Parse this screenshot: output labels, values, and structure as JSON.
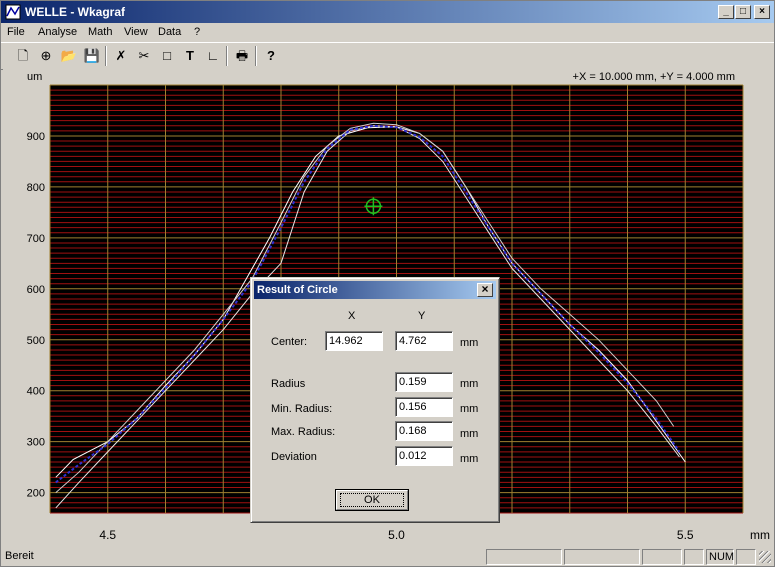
{
  "window": {
    "title": "WELLE - Wkagraf"
  },
  "title_buttons": {
    "minimize": "_",
    "maximize": "□",
    "close": "×"
  },
  "menu": [
    "File",
    "Analyse",
    "Math",
    "View",
    "Data",
    "?"
  ],
  "toolbar": {
    "tools": [
      {
        "name": "new-icon",
        "glyph": "🗋"
      },
      {
        "name": "add-icon",
        "glyph": "⊕"
      },
      {
        "name": "open-icon",
        "glyph": "📂"
      },
      {
        "name": "save-icon",
        "glyph": "💾"
      },
      {
        "name": "cut-x-icon",
        "glyph": "✗"
      },
      {
        "name": "scissors-icon",
        "glyph": "✂"
      },
      {
        "name": "rectangle-icon",
        "glyph": "□"
      },
      {
        "name": "text-icon",
        "glyph": "T"
      },
      {
        "name": "axis-icon",
        "glyph": "∟"
      },
      {
        "name": "print-icon",
        "glyph": "🖶"
      },
      {
        "name": "help-icon",
        "glyph": "?"
      }
    ]
  },
  "chart_header": {
    "unit_left": "um",
    "scale_info": "+X = 10.000 mm, +Y = 4.000 mm"
  },
  "chart_data": {
    "type": "line",
    "xlabel": "mm",
    "ylabel": "um",
    "xlim": [
      4.4,
      5.6
    ],
    "ylim": [
      160,
      1000
    ],
    "x_ticks": [
      "4.5",
      "5.0",
      "5.5"
    ],
    "y_ticks": [
      "200",
      "300",
      "400",
      "500",
      "600",
      "700",
      "800",
      "900"
    ],
    "background": "#000000",
    "grid_color_minor": "#a01010",
    "grid_color_major": "#a08030",
    "series": [
      {
        "color": "#ffffff",
        "values": [
          [
            4.41,
            230
          ],
          [
            4.44,
            265
          ],
          [
            4.5,
            300
          ],
          [
            4.55,
            345
          ],
          [
            4.6,
            410
          ],
          [
            4.65,
            470
          ],
          [
            4.7,
            540
          ],
          [
            4.74,
            620
          ],
          [
            4.78,
            700
          ],
          [
            4.82,
            790
          ],
          [
            4.86,
            860
          ],
          [
            4.9,
            900
          ],
          [
            4.95,
            916
          ],
          [
            5.0,
            918
          ],
          [
            5.04,
            905
          ],
          [
            5.08,
            870
          ],
          [
            5.12,
            800
          ],
          [
            5.16,
            720
          ],
          [
            5.2,
            650
          ],
          [
            5.25,
            590
          ],
          [
            5.3,
            530
          ],
          [
            5.35,
            480
          ],
          [
            5.4,
            420
          ],
          [
            5.45,
            340
          ],
          [
            5.5,
            260
          ]
        ]
      },
      {
        "color": "#e8e8e8",
        "values": [
          [
            4.41,
            170
          ],
          [
            4.45,
            220
          ],
          [
            4.5,
            280
          ],
          [
            4.55,
            340
          ],
          [
            4.6,
            400
          ],
          [
            4.65,
            460
          ],
          [
            4.7,
            520
          ],
          [
            4.75,
            590
          ],
          [
            4.8,
            650
          ],
          [
            4.84,
            790
          ],
          [
            4.88,
            870
          ],
          [
            4.92,
            910
          ],
          [
            4.96,
            920
          ],
          [
            5.0,
            918
          ],
          [
            5.04,
            895
          ],
          [
            5.08,
            850
          ],
          [
            5.12,
            780
          ],
          [
            5.16,
            710
          ],
          [
            5.2,
            640
          ],
          [
            5.25,
            580
          ],
          [
            5.3,
            520
          ],
          [
            5.35,
            460
          ],
          [
            5.4,
            400
          ],
          [
            5.45,
            330
          ],
          [
            5.49,
            270
          ]
        ]
      },
      {
        "color": "#d0d0d0",
        "values": [
          [
            4.41,
            200
          ],
          [
            4.45,
            240
          ],
          [
            4.5,
            300
          ],
          [
            4.55,
            360
          ],
          [
            4.6,
            420
          ],
          [
            4.65,
            480
          ],
          [
            4.7,
            550
          ],
          [
            4.75,
            620
          ],
          [
            4.8,
            730
          ],
          [
            4.84,
            820
          ],
          [
            4.88,
            880
          ],
          [
            4.92,
            915
          ],
          [
            4.96,
            925
          ],
          [
            5.0,
            922
          ],
          [
            5.04,
            905
          ],
          [
            5.08,
            870
          ],
          [
            5.12,
            800
          ],
          [
            5.16,
            730
          ],
          [
            5.2,
            660
          ],
          [
            5.25,
            600
          ],
          [
            5.3,
            550
          ],
          [
            5.35,
            500
          ],
          [
            5.4,
            440
          ],
          [
            5.45,
            380
          ],
          [
            5.48,
            330
          ]
        ]
      },
      {
        "color": "#3030d0",
        "values": [
          [
            4.41,
            220
          ],
          [
            4.45,
            255
          ],
          [
            4.5,
            295
          ],
          [
            4.55,
            345
          ],
          [
            4.6,
            405
          ],
          [
            4.65,
            470
          ],
          [
            4.7,
            540
          ],
          [
            4.75,
            615
          ],
          [
            4.8,
            720
          ],
          [
            4.84,
            810
          ],
          [
            4.88,
            875
          ],
          [
            4.92,
            912
          ],
          [
            4.96,
            920
          ],
          [
            5.0,
            917
          ],
          [
            5.04,
            898
          ],
          [
            5.08,
            860
          ],
          [
            5.12,
            790
          ],
          [
            5.16,
            720
          ],
          [
            5.2,
            650
          ],
          [
            5.25,
            590
          ],
          [
            5.3,
            530
          ],
          [
            5.35,
            475
          ],
          [
            5.4,
            415
          ],
          [
            5.45,
            345
          ],
          [
            5.49,
            280
          ]
        ]
      }
    ],
    "marker": {
      "x": 4.96,
      "y": 762,
      "color": "#20c020"
    }
  },
  "dialog": {
    "title": "Result of Circle",
    "col_x": "X",
    "col_y": "Y",
    "center_label": "Center:",
    "center_x": "14.962",
    "center_y": "4.762",
    "unit": "mm",
    "rows": [
      {
        "label": "Radius",
        "value": "0.159"
      },
      {
        "label": "Min. Radius:",
        "value": "0.156"
      },
      {
        "label": "Max. Radius:",
        "value": "0.168"
      },
      {
        "label": "Deviation",
        "value": "0.012"
      }
    ],
    "ok_label": "OK",
    "close_glyph": "×"
  },
  "status": {
    "text": "Bereit",
    "num": "NUM"
  }
}
